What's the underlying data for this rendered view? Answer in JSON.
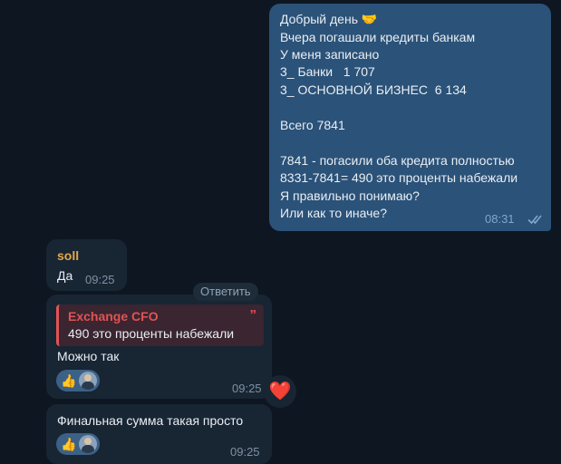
{
  "messages": {
    "outgoing": {
      "lines": [
        "Добрый день 🤝",
        "Вчера погашали кредиты банкам",
        "У меня записано",
        "3_ Банки   1 707",
        "3_ ОСНОВНОЙ БИЗНЕС  6 134",
        "",
        "Всего 7841",
        "",
        "7841 - погасили оба кредита полностью",
        "8331-7841= 490 это проценты набежали",
        "Я правильно понимаю?",
        "Или как то иначе?"
      ],
      "time": "08:31",
      "status": "read"
    },
    "soll": {
      "sender": "soll",
      "text": "Да",
      "time": "09:25"
    },
    "reply_message": {
      "quote_author": "Exchange CFO",
      "quote_text": "490 это проценты набежали",
      "text": "Можно так",
      "time": "09:25",
      "reactions": {
        "emoji": "👍",
        "avatar": "user-avatar"
      }
    },
    "final_message": {
      "text": "Финальная сумма такая просто",
      "time": "09:25",
      "reactions": {
        "emoji": "👍",
        "avatar": "user-avatar"
      }
    }
  },
  "reply_button_label": "Ответить",
  "heart_reaction": "❤️",
  "colors": {
    "background": "#0e1621",
    "outgoing_bubble": "#2b5278",
    "incoming_bubble": "#182533",
    "sender_name": "#e4a94a",
    "quote_accent": "#e25353",
    "reaction_pill": "#3c6187"
  }
}
